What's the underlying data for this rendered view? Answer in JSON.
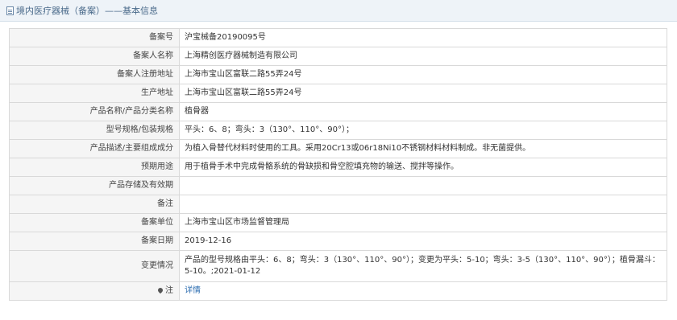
{
  "header": {
    "title": "境内医疗器械（备案）——基本信息"
  },
  "rows": [
    {
      "label": "备案号",
      "value": "沪宝械备20190095号"
    },
    {
      "label": "备案人名称",
      "value": "上海精创医疗器械制造有限公司"
    },
    {
      "label": "备案人注册地址",
      "value": "上海市宝山区富联二路55弄24号"
    },
    {
      "label": "生产地址",
      "value": "上海市宝山区富联二路55弄24号"
    },
    {
      "label": "产品名称/产品分类名称",
      "value": "植骨器"
    },
    {
      "label": "型号规格/包装规格",
      "value": "平头：6、8；弯头：3（130°、110°、90°）；"
    },
    {
      "label": "产品描述/主要组成成分",
      "value": "为植入骨替代材料时使用的工具。采用20Cr13或06r18Ni10不锈钢材料材料制成。非无菌提供。"
    },
    {
      "label": "预期用途",
      "value": "用于植骨手术中完成骨骼系统的骨缺损和骨空腔填充物的输送、搅拌等操作。"
    },
    {
      "label": "产品存储及有效期",
      "value": ""
    },
    {
      "label": "备注",
      "value": ""
    },
    {
      "label": "备案单位",
      "value": "上海市宝山区市场监督管理局"
    },
    {
      "label": "备案日期",
      "value": "2019-12-16"
    },
    {
      "label": "变更情况",
      "value": "产品的型号规格由平头：6、8；弯头：3（130°、110°、90°）；变更为平头：5-10；弯头：3-5（130°、110°、90°）；植骨漏斗：5-10。;2021-01-12"
    },
    {
      "label": "注",
      "value": "详情"
    }
  ]
}
